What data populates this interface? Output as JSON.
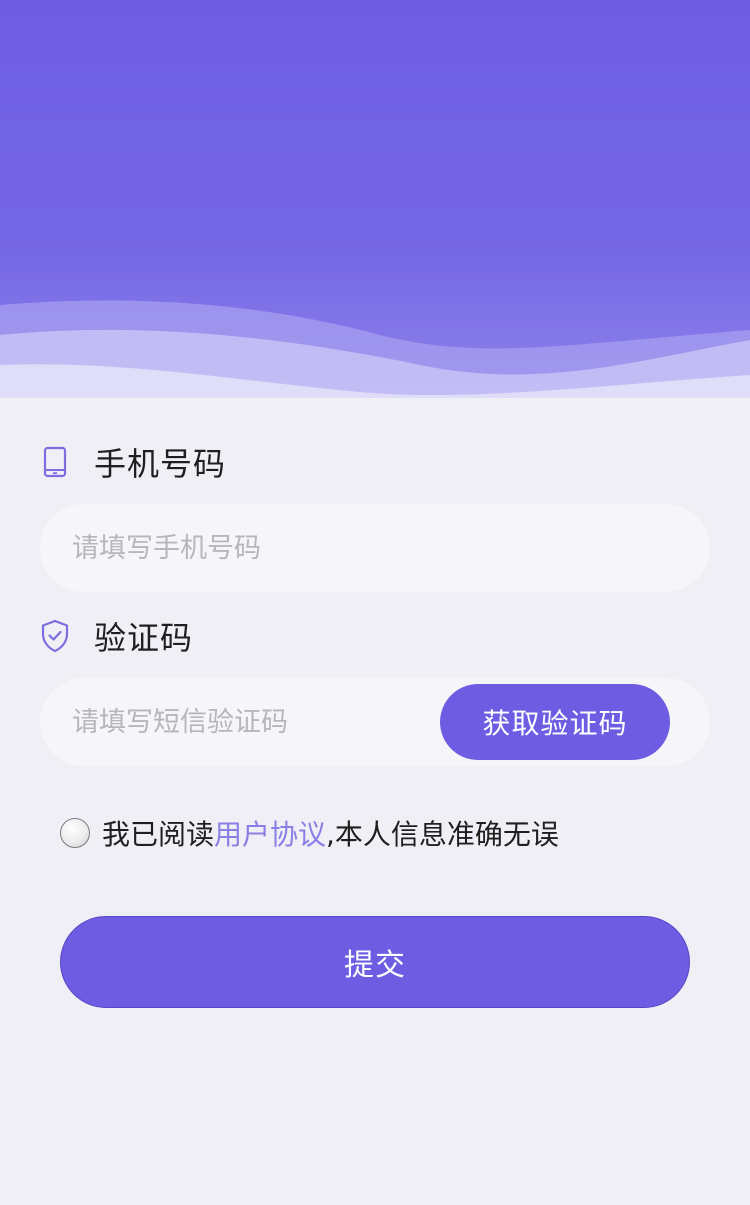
{
  "theme": {
    "accent": "#6e5de3",
    "header_top": "#6e5de3",
    "link_color": "#8a7fe6",
    "background": "#f0eff5",
    "input_bg": "#f6f6f8",
    "placeholder_color": "#b6b6bb"
  },
  "phone": {
    "label": "手机号码",
    "icon": "tablet-icon",
    "placeholder": "请填写手机号码",
    "value": ""
  },
  "code": {
    "label": "验证码",
    "icon": "shield-check-icon",
    "placeholder": "请填写短信验证码",
    "value": "",
    "get_code_label": "获取验证码"
  },
  "agreement": {
    "checked": false,
    "prefix": "我已阅读",
    "link": "用户协议",
    "suffix": ",本人信息准确无误"
  },
  "submit": {
    "label": "提交"
  }
}
